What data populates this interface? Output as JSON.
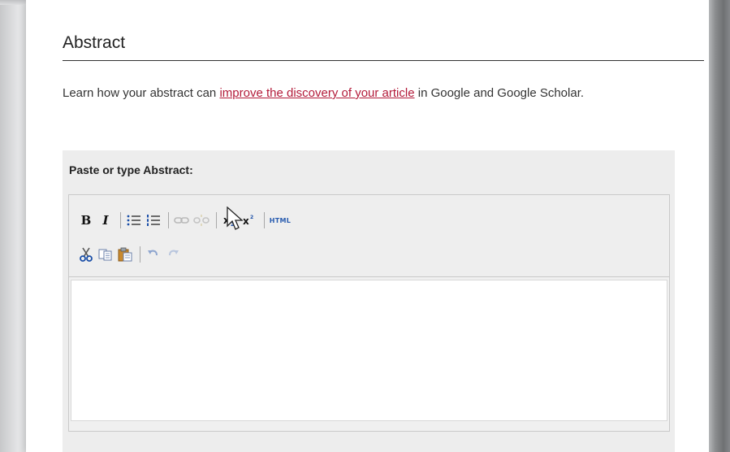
{
  "section": {
    "title": "Abstract",
    "intro_before": "Learn how your abstract can ",
    "intro_link": "improve the discovery of your article",
    "intro_after": " in Google and Google Scholar."
  },
  "editor": {
    "label": "Paste or type Abstract:",
    "value": "",
    "toolbar": {
      "bold": "B",
      "italic": "I",
      "html": "HTML",
      "icons_row1": [
        "bold-icon",
        "italic-icon",
        "bullet-list-icon",
        "numbered-list-icon",
        "link-icon",
        "unlink-icon",
        "subscript-icon",
        "superscript-icon",
        "html-source-icon"
      ],
      "icons_row2": [
        "cut-icon",
        "copy-icon",
        "paste-icon",
        "undo-icon",
        "redo-icon"
      ]
    }
  },
  "colors": {
    "link": "#b31b3a",
    "panel_bg": "#ededed",
    "html_button": "#2a5db0"
  }
}
